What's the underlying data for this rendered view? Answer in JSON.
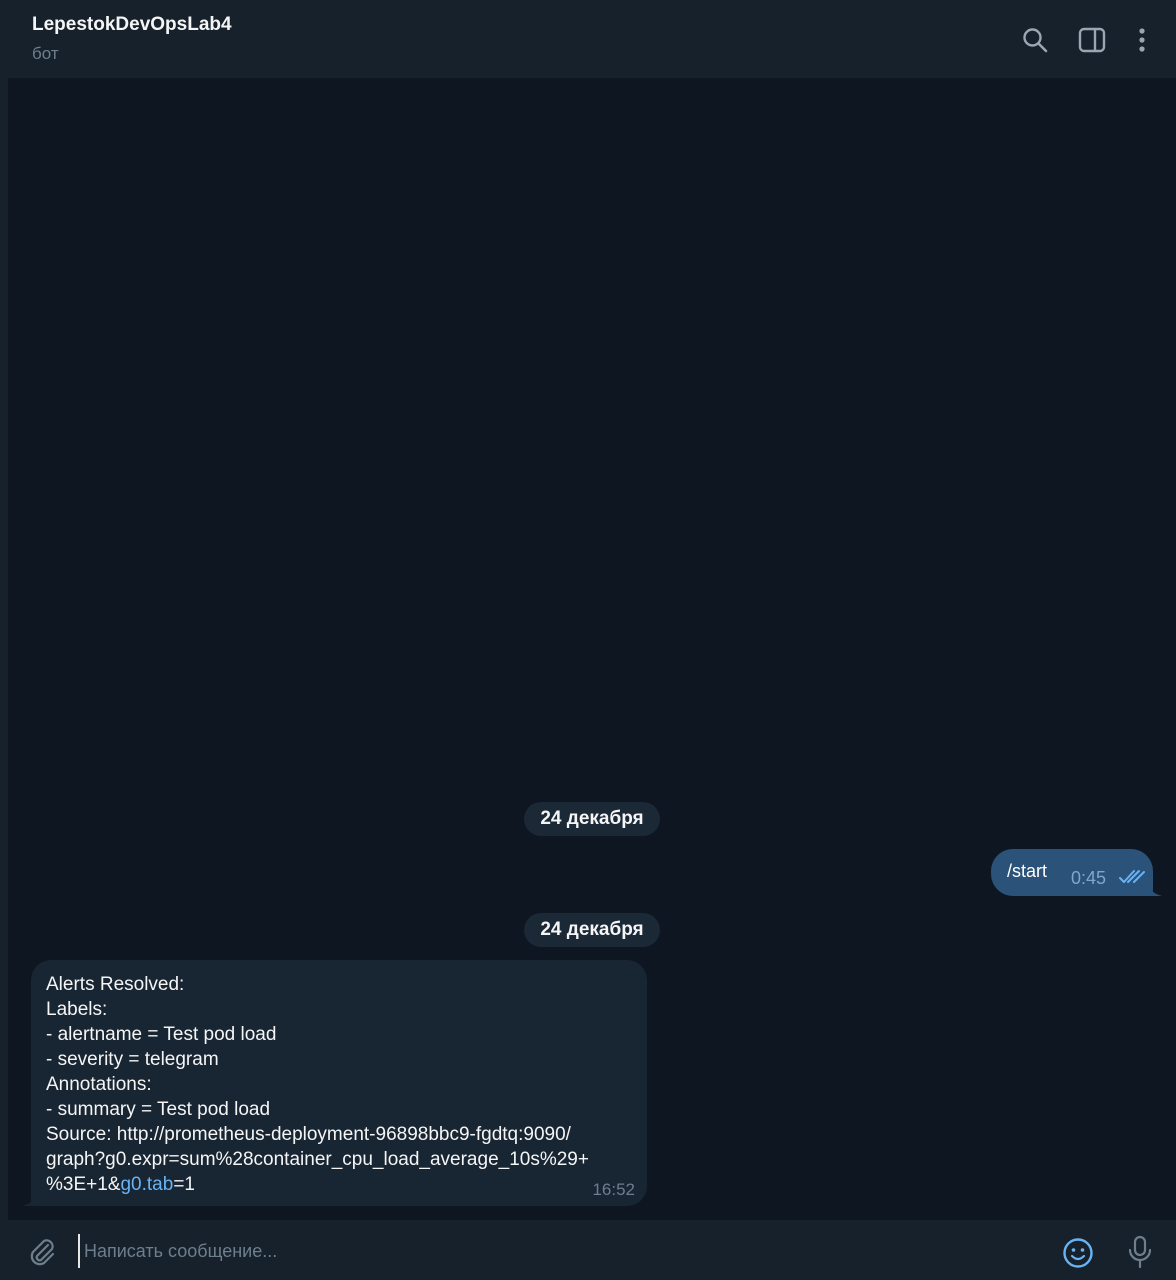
{
  "header": {
    "title": "LepestokDevOpsLab4",
    "subtitle": "бот",
    "icons": [
      "search-icon",
      "sidebar-toggle-icon",
      "more-vertical-icon"
    ]
  },
  "messages": {
    "date_separator_1": "24 декабря",
    "outgoing": {
      "text": "/start",
      "time": "0:45",
      "status_icon": "double-check-icon"
    },
    "date_separator_2": "24 декабря",
    "incoming": {
      "lines": [
        "Alerts Resolved:",
        "Labels:",
        "- alertname = Test pod load",
        "- severity = telegram",
        "Annotations:",
        "- summary = Test pod load",
        "Source: http://prometheus-deployment-96898bbc9-fgdtq:9090/",
        "graph?g0.expr=sum%28container_cpu_load_average_10s%29+"
      ],
      "last_line_prefix": "%3E+1&",
      "last_line_link": "g0.tab",
      "last_line_suffix": "=1",
      "time": "16:52"
    }
  },
  "composer": {
    "placeholder": "Написать сообщение...",
    "value": "",
    "icons": [
      "paperclip-icon",
      "emoji-icon",
      "microphone-icon"
    ]
  },
  "colors": {
    "background": "#0e1621",
    "header": "#17212b",
    "outgoing_bubble": "#2b5278",
    "incoming_bubble": "#182533",
    "link": "#6ab3f3",
    "muted": "#6d7f8f"
  }
}
